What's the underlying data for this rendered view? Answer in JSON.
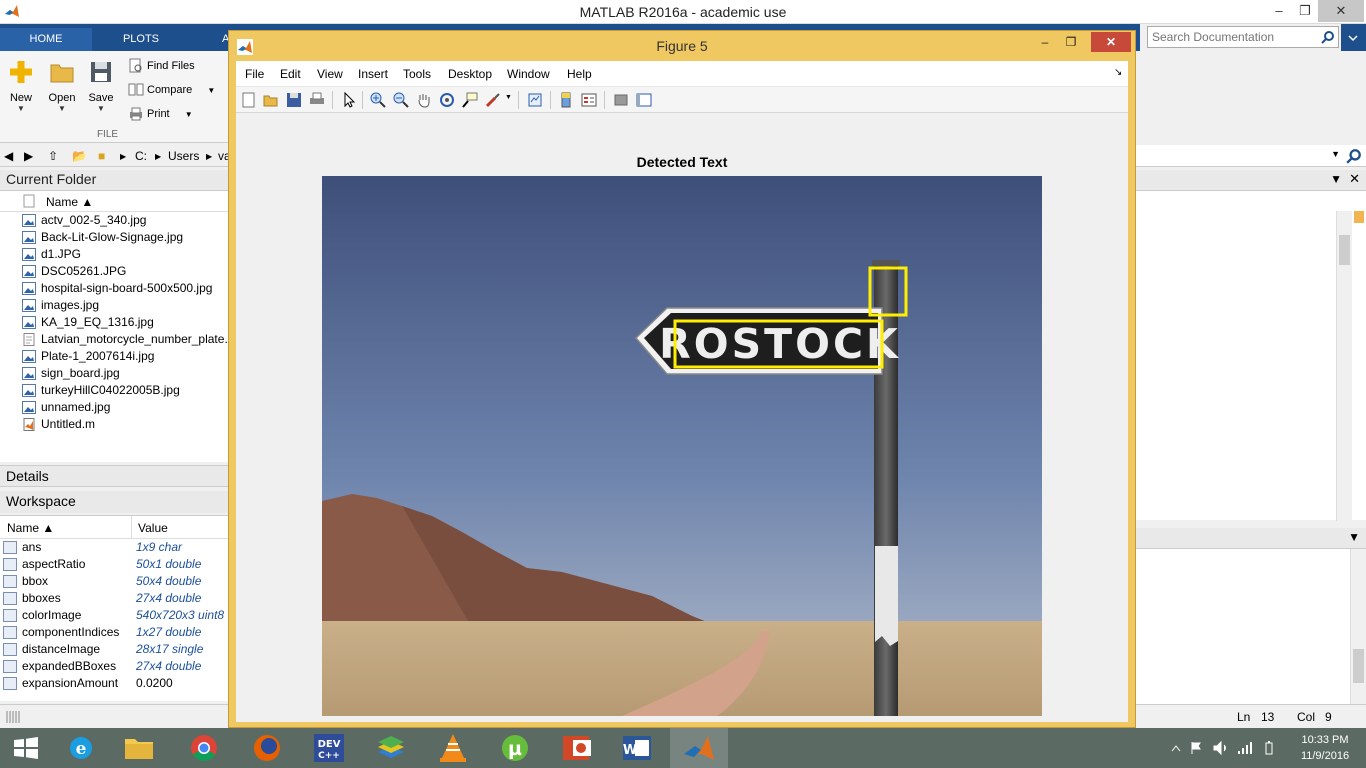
{
  "window": {
    "title": "MATLAB R2016a - academic use",
    "minimize": "–",
    "maximize": "❐",
    "close": "✕"
  },
  "ribbon": {
    "tabs": [
      "HOME",
      "PLOTS",
      "A"
    ],
    "new_label": "New",
    "open_label": "Open",
    "save_label": "Save",
    "find_files": "Find Files",
    "compare": "Compare",
    "print": "Print",
    "group_label": "FILE",
    "search_placeholder": "Search Documentation"
  },
  "address": [
    "C:",
    "Users",
    "va"
  ],
  "current_folder": {
    "title": "Current Folder",
    "col_name": "Name ▲",
    "files": [
      {
        "name": "actv_002-5_340.jpg",
        "type": "image"
      },
      {
        "name": "Back-Lit-Glow-Signage.jpg",
        "type": "image"
      },
      {
        "name": "d1.JPG",
        "type": "image"
      },
      {
        "name": "DSC05261.JPG",
        "type": "image"
      },
      {
        "name": "hospital-sign-board-500x500.jpg",
        "type": "image"
      },
      {
        "name": "images.jpg",
        "type": "image"
      },
      {
        "name": "KA_19_EQ_1316.jpg",
        "type": "image"
      },
      {
        "name": "Latvian_motorcycle_number_plate.p",
        "type": "doc"
      },
      {
        "name": "Plate-1_2007614i.jpg",
        "type": "image"
      },
      {
        "name": "sign_board.jpg",
        "type": "image"
      },
      {
        "name": "turkeyHillC04022005B.jpg",
        "type": "image"
      },
      {
        "name": "unnamed.jpg",
        "type": "image"
      },
      {
        "name": "Untitled.m",
        "type": "script"
      }
    ]
  },
  "details": {
    "title": "Details"
  },
  "workspace": {
    "title": "Workspace",
    "col_name": "Name ▲",
    "col_value": "Value",
    "vars": [
      {
        "name": "ans",
        "value": "1x9 char"
      },
      {
        "name": "aspectRatio",
        "value": "50x1 double"
      },
      {
        "name": "bbox",
        "value": "50x4 double"
      },
      {
        "name": "bboxes",
        "value": "27x4 double"
      },
      {
        "name": "colorImage",
        "value": "540x720x3 uint8"
      },
      {
        "name": "componentIndices",
        "value": "1x27 double"
      },
      {
        "name": "distanceImage",
        "value": "28x17 single"
      },
      {
        "name": "expandedBBoxes",
        "value": "27x4 double"
      },
      {
        "name": "expansionAmount",
        "value": "0.0200"
      }
    ]
  },
  "status": {
    "ln_label": "Ln",
    "ln": "13",
    "col_label": "Col",
    "col": "9"
  },
  "figure": {
    "title": "Figure 5",
    "menu": [
      "File",
      "Edit",
      "View",
      "Insert",
      "Tools",
      "Desktop",
      "Window",
      "Help"
    ],
    "axes_title": "Detected Text",
    "sign_text": "ROSTOCK",
    "box_color": "#ffee00"
  },
  "taskbar": {
    "apps": [
      "start",
      "ie",
      "explorer",
      "chrome",
      "firefox",
      "devcpp",
      "bluestacks",
      "vlc",
      "utorrent",
      "powerpoint",
      "word",
      "matlab"
    ],
    "time": "10:33 PM",
    "date": "11/9/2016"
  },
  "colors": {
    "ribbon": "#1d4f8c",
    "figure_frame": "#f0c862",
    "taskbar": "#5b6a63"
  }
}
